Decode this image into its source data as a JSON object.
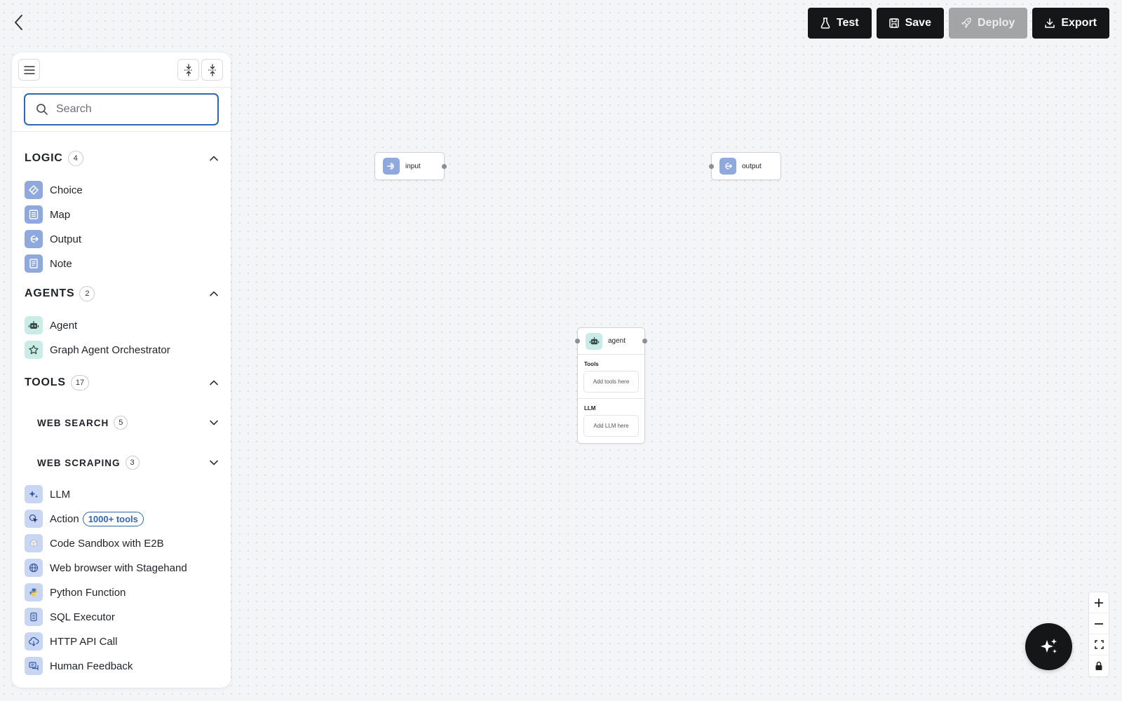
{
  "topbar": {
    "test_label": "Test",
    "save_label": "Save",
    "deploy_label": "Deploy",
    "export_label": "Export"
  },
  "search": {
    "placeholder": "Search"
  },
  "sections": {
    "logic": {
      "title": "LOGIC",
      "count": "4",
      "expanded": true,
      "items": [
        {
          "label": "Choice",
          "icon": "choice-icon"
        },
        {
          "label": "Map",
          "icon": "map-icon"
        },
        {
          "label": "Output",
          "icon": "output-icon"
        },
        {
          "label": "Note",
          "icon": "note-icon"
        }
      ]
    },
    "agents": {
      "title": "AGENTS",
      "count": "2",
      "expanded": true,
      "items": [
        {
          "label": "Agent",
          "icon": "robot-icon"
        },
        {
          "label": "Graph Agent Orchestrator",
          "icon": "star-outline-icon"
        }
      ]
    },
    "tools": {
      "title": "TOOLS",
      "count": "17",
      "expanded": true,
      "subsections": [
        {
          "title": "WEB SEARCH",
          "count": "5",
          "expanded": false
        },
        {
          "title": "WEB SCRAPING",
          "count": "3",
          "expanded": false
        }
      ],
      "items": [
        {
          "label": "LLM",
          "icon": "sparkle-icon"
        },
        {
          "label": "Action",
          "icon": "action-cursor-icon",
          "badge": "1000+ tools"
        },
        {
          "label": "Code Sandbox with E2B",
          "icon": "cube-icon"
        },
        {
          "label": "Web browser with Stagehand",
          "icon": "globe-icon"
        },
        {
          "label": "Python Function",
          "icon": "python-icon"
        },
        {
          "label": "SQL Executor",
          "icon": "database-icon"
        },
        {
          "label": "HTTP API Call",
          "icon": "cloud-icon"
        },
        {
          "label": "Human Feedback",
          "icon": "chat-icon"
        }
      ]
    }
  },
  "canvas": {
    "nodes": {
      "input": {
        "label": "input"
      },
      "output": {
        "label": "output"
      },
      "agent": {
        "label": "agent",
        "tools_label": "Tools",
        "tools_placeholder": "Add tools here",
        "llm_label": "LLM",
        "llm_placeholder": "Add LLM here"
      }
    }
  },
  "colors": {
    "accent": "#2f67b3",
    "button_dark": "#151617",
    "button_disabled": "#a3a4a6",
    "icon_blue": "#8fa8de",
    "icon_teal": "#c9ede6"
  }
}
